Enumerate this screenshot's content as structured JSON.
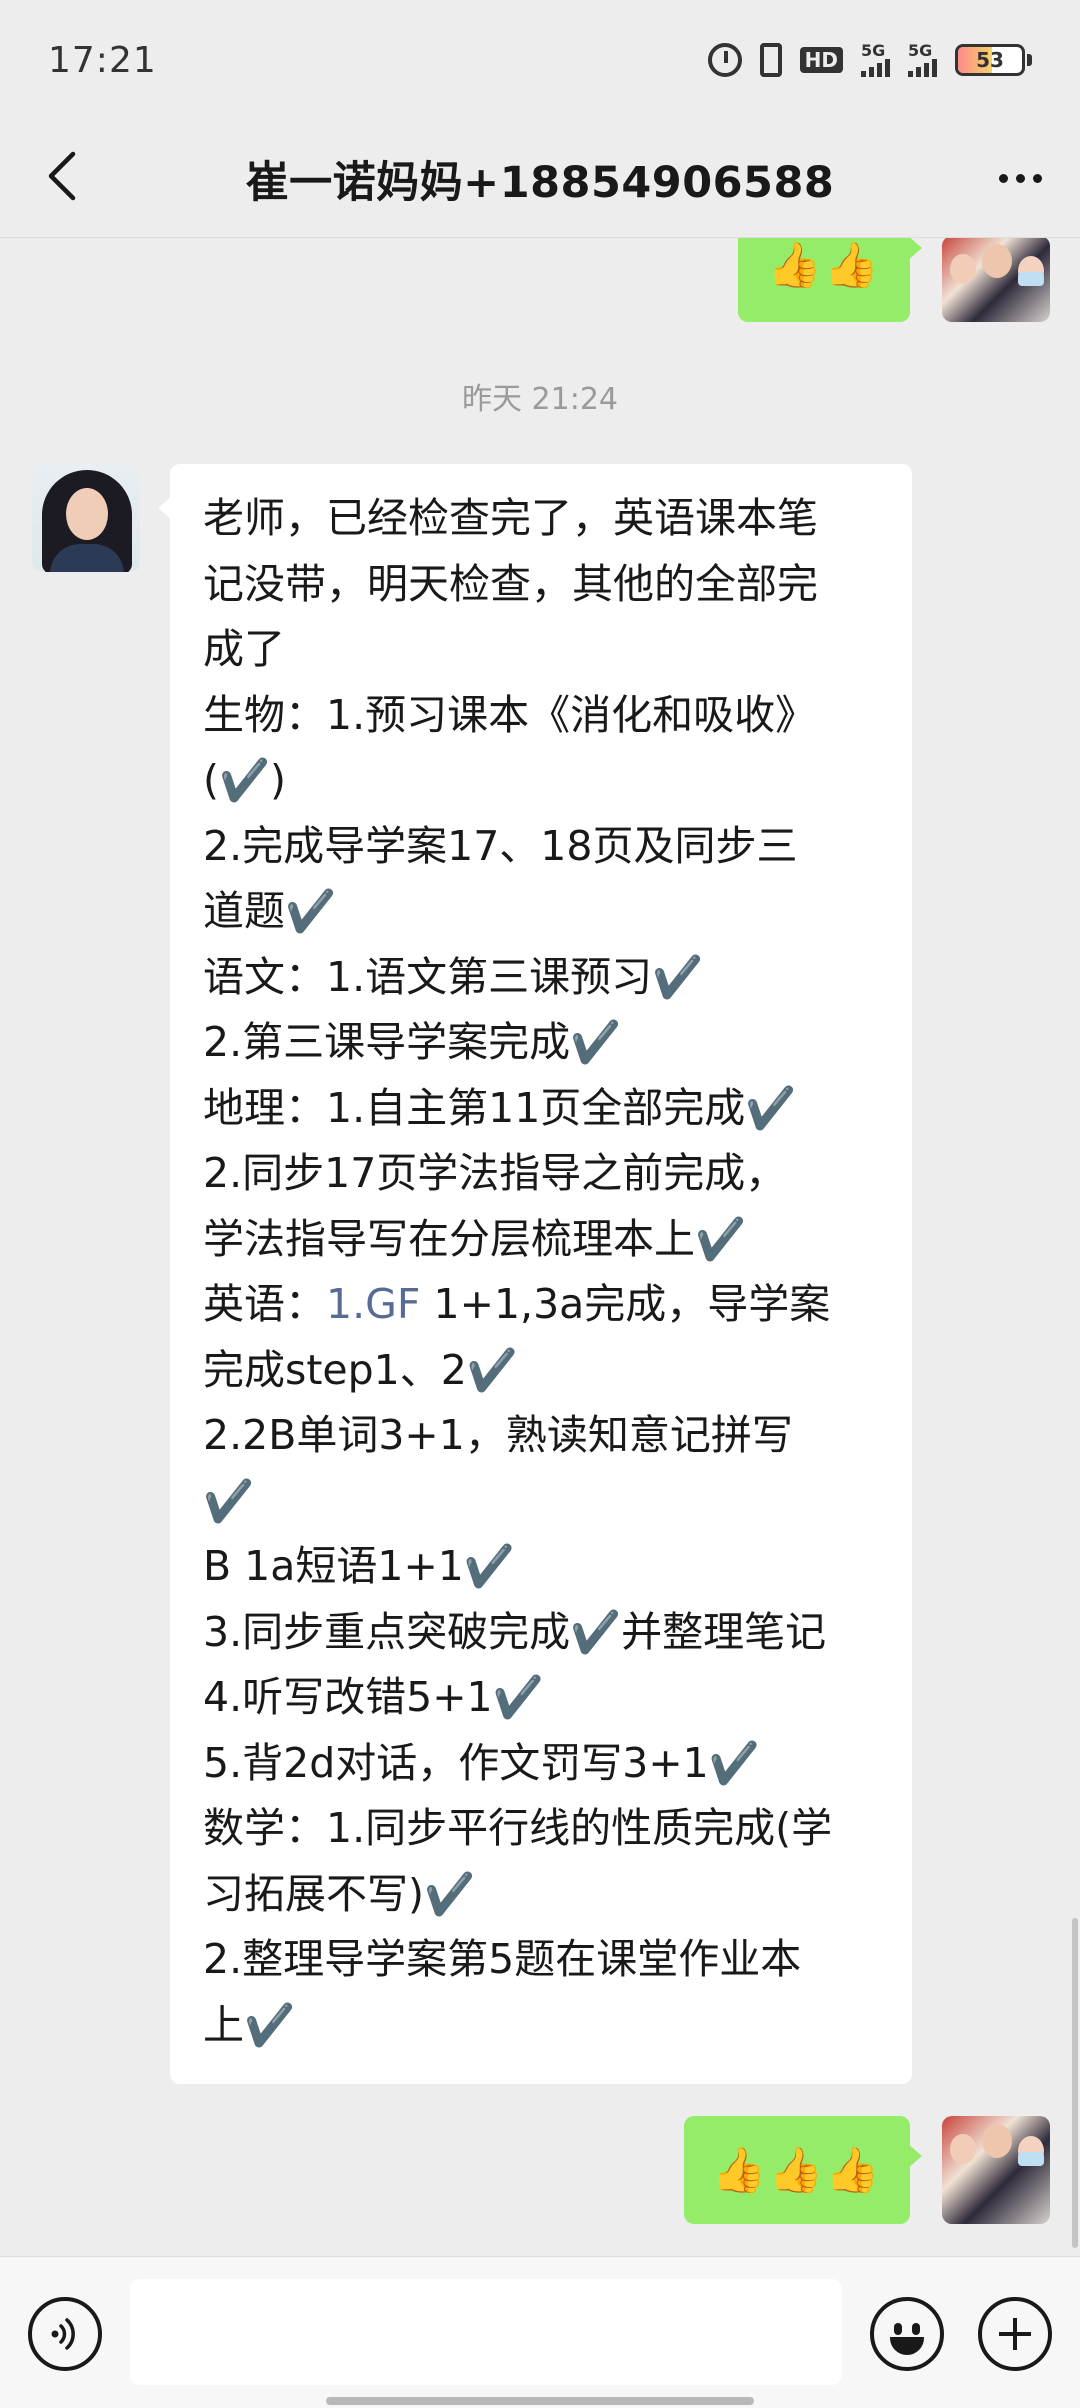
{
  "status_bar": {
    "time": "17:21",
    "hd_label": "HD",
    "signal_1_label": "5G",
    "signal_2_label": "5G",
    "battery_level": "53",
    "battery_percent": 53
  },
  "nav": {
    "title": "崔一诺妈妈+18854906588"
  },
  "messages": {
    "top_sent": {
      "text": "👍👍"
    },
    "timestamp": "昨天 21:24",
    "received_lines": [
      "老师，已经检查完了，英语课本笔",
      "记没带，明天检查，其他的全部完",
      "成了",
      "生物：1.预习课本《消化和吸收》",
      "(✔️)",
      "2.完成导学案17、18页及同步三",
      "道题✔️",
      "语文：1.语文第三课预习✔️",
      "2.第三课导学案完成✔️",
      "地理：1.自主第11页全部完成✔️",
      "2.同步17页学法指导之前完成，",
      "学法指导写在分层梳理本上✔️",
      {
        "prefix": "英语：",
        "link": "1.GF",
        "suffix": " 1+1,3a完成，导学案"
      },
      "完成step1、2✔️",
      "2.2B单词3+1，熟读知意记拼写",
      "✔️",
      "B 1a短语1+1✔️",
      "3.同步重点突破完成✔️并整理笔记",
      "4.听写改错5+1✔️",
      "5.背2d对话，作文罚写3+1✔️",
      "数学：1.同步平行线的性质完成(学",
      "习拓展不写)✔️",
      "2.整理导学案第5题在课堂作业本",
      "上✔️"
    ],
    "bottom_sent": {
      "text": "👍👍👍"
    }
  },
  "input_bar": {
    "placeholder": ""
  },
  "colors": {
    "background": "#ededed",
    "sent_bubble": "#95ec69",
    "received_bubble": "#ffffff",
    "link": "#576b95"
  }
}
